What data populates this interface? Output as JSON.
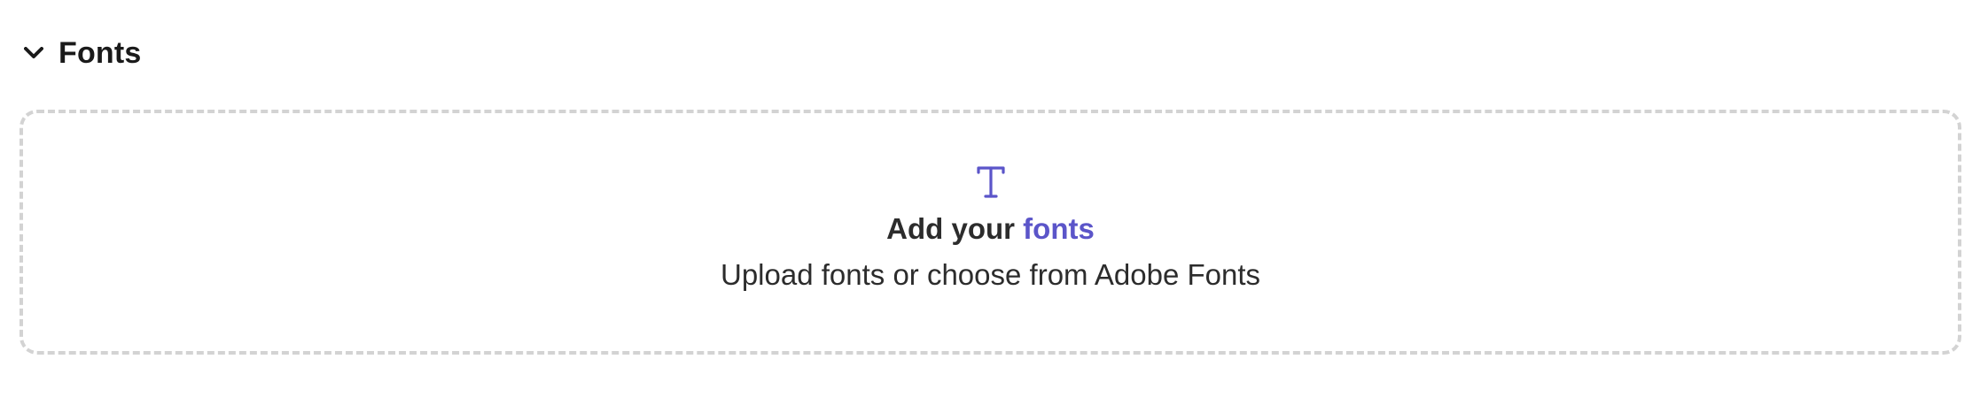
{
  "section": {
    "title": "Fonts",
    "expanded": true,
    "icon": "chevron-down-icon"
  },
  "dropzone": {
    "icon": "type-icon",
    "title_prefix": "Add your ",
    "title_link": "fonts",
    "subtitle": "Upload fonts or choose from Adobe Fonts"
  },
  "colors": {
    "accent": "#5b55c9",
    "border": "#d3d3d3",
    "text": "#2c2c2c"
  }
}
